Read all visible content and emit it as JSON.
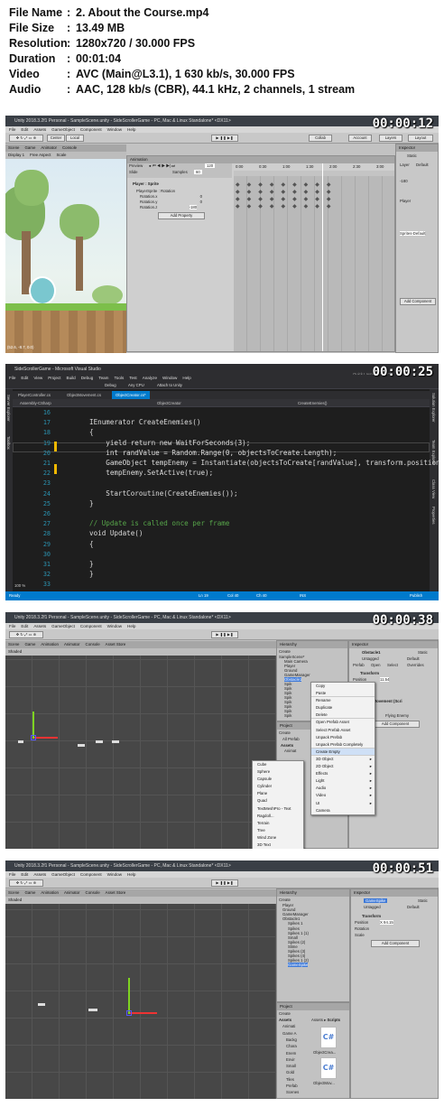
{
  "info": {
    "rows": [
      {
        "key": "File Name",
        "value": "2. About the Course.mp4"
      },
      {
        "key": "File Size",
        "value": "13.49 MB"
      },
      {
        "key": "Resolution",
        "value": "1280x720 / 30.000 FPS"
      },
      {
        "key": "Duration",
        "value": "00:01:04"
      },
      {
        "key": "Video",
        "value": "AVC (Main@L3.1), 1 630 kb/s, 30.000 FPS"
      },
      {
        "key": "Audio",
        "value": "AAC, 128 kb/s (CBR), 44.1 kHz, 2 channels, 1 stream"
      }
    ]
  },
  "frames": [
    {
      "timestamp": "00:00:12",
      "title": "Unity 2018.3.2f1 Personal - SampleScene.unity - SideScrollerGame - PC, Mac & Linux Standalone* <DX11>",
      "menu": [
        "File",
        "Edit",
        "Assets",
        "GameObject",
        "Component",
        "Window",
        "Help"
      ],
      "tool": {
        "center": "Center",
        "local": "Local",
        "collab": "Collab",
        "account": "Account",
        "layers": "Layers",
        "layout": "Layout"
      },
      "tabs": [
        "Scene",
        "Game",
        "Animator",
        "Console"
      ],
      "display": "Display 1",
      "aspect": "Free Aspect",
      "scale": "Scale",
      "animation": {
        "tab": "Animation",
        "preview": "Preview",
        "clip": "Slide",
        "samples_label": "Samples",
        "samples": "60",
        "frame_value": "120",
        "time_marks": [
          "0:00",
          "0:30",
          "1:00",
          "1:30",
          "2:00",
          "2:30",
          "3:00"
        ],
        "object": "Player : Sprite",
        "group": "PlayerSprite : Rotation",
        "props": [
          {
            "name": "Rotation.x",
            "value": "0"
          },
          {
            "name": "Rotation.y",
            "value": "0"
          },
          {
            "name": "Rotation.z",
            "value": "-180"
          }
        ],
        "add_button": "Add Property"
      },
      "coords": "(52.6, -8.7, 0.0)",
      "inspector": {
        "tab": "Inspector",
        "static": "Static",
        "layer": "Layer",
        "default": "Default",
        "player": "Player",
        "value": "-180",
        "sprite_default": "Sprites-Default",
        "add_component": "Add Component"
      }
    },
    {
      "timestamp": "00:00:25",
      "title": "SideScrollerGame - Microsoft Visual Studio",
      "quick_launch": "Quick Launch (Ctrl+Q)",
      "user": "Phanender",
      "menu": [
        "File",
        "Edit",
        "View",
        "Project",
        "Build",
        "Debug",
        "Team",
        "Tools",
        "Test",
        "Analyze",
        "Window",
        "Help"
      ],
      "toolbar": {
        "debug": "Debug",
        "cpu": "Any CPU",
        "attach": "Attach to Unity"
      },
      "file_tabs": [
        "PlayerController.cs",
        "ObjectMovement.cs",
        "ObjectCreator.cs*"
      ],
      "nav": {
        "project": "Assembly-CSharp",
        "class": "ObjectCreator",
        "method": "CreateEnemies()"
      },
      "side_left": [
        "Server Explorer",
        "Toolbox"
      ],
      "side_right": [
        "Solution Explorer",
        "Team Explorer",
        "Class View",
        "Properties"
      ],
      "code": [
        {
          "n": "16",
          "t": ""
        },
        {
          "n": "17",
          "t": "IEnumerator CreateEnemies()"
        },
        {
          "n": "18",
          "t": "{"
        },
        {
          "n": "19",
          "t": "    yield return new WaitForSeconds(3);"
        },
        {
          "n": "20",
          "t": "    int randValue = Random.Range(0, objectsToCreate.Length);"
        },
        {
          "n": "21",
          "t": "    GameObject tempEnemy = Instantiate(objectsToCreate[randValue], transform.position"
        },
        {
          "n": "22",
          "t": "    tempEnemy.SetActive(true);"
        },
        {
          "n": "23",
          "t": ""
        },
        {
          "n": "24",
          "t": "    StartCoroutine(CreateEnemies());"
        },
        {
          "n": "25",
          "t": "}"
        },
        {
          "n": "26",
          "t": ""
        },
        {
          "n": "27",
          "t": "// Update is called once per frame"
        },
        {
          "n": "28",
          "t": "void Update()"
        },
        {
          "n": "29",
          "t": "{"
        },
        {
          "n": "30",
          "t": ""
        },
        {
          "n": "31",
          "t": "}"
        },
        {
          "n": "32",
          "t": "}"
        },
        {
          "n": "33",
          "t": ""
        }
      ],
      "zoom": "100 %",
      "status": {
        "ready": "Ready",
        "ln": "Ln 19",
        "col": "Col 40",
        "ch": "Ch 40",
        "ins": "INS",
        "publish": "Publish"
      }
    },
    {
      "timestamp": "00:00:38",
      "title": "Unity 2018.3.2f1 Personal - SampleScene.unity - SideScrollerGame - PC, Mac & Linux Standalone* <DX11>",
      "menu": [
        "File",
        "Edit",
        "Assets",
        "GameObject",
        "Component",
        "Window",
        "Help"
      ],
      "tabs": [
        "Scene",
        "Game",
        "Animation",
        "Animator",
        "Console",
        "Asset Store"
      ],
      "shaded": "Shaded",
      "hierarchy": {
        "tab": "Hierarchy",
        "create": "Create",
        "items": [
          "SampleScene*",
          "Main Camera",
          "Player",
          "Ground",
          "GameManager",
          "Obstacle1",
          "Spik",
          "Spik",
          "Spik",
          "Spik",
          "Spik",
          "Spik",
          "Spik",
          "Spik"
        ]
      },
      "context_menu": [
        "Copy",
        "Paste",
        "Rename",
        "Duplicate",
        "Delete",
        "Open Prefab Asset",
        "Select Prefab Asset",
        "Unpack Prefab",
        "Unpack Prefab Completely",
        "Create Empty",
        "3D Object",
        "2D Object",
        "Effects",
        "Light",
        "Audio",
        "Video",
        "UI",
        "Camera"
      ],
      "submenu": [
        "Cube",
        "Sphere",
        "Capsule",
        "Cylinder",
        "Plane",
        "Quad",
        "TextMeshPro - Text",
        "Ragdoll...",
        "Terrain",
        "Tree",
        "Wind Zone",
        "3D Text"
      ],
      "inspector": {
        "tab": "Inspector",
        "name": "Obstacle1",
        "static": "Static",
        "tag": "Untagged",
        "layer": "Default",
        "prefab": "Prefab",
        "open": "Open",
        "select": "Select",
        "overrides": "Overrides",
        "transform": "Transform",
        "position": "Position",
        "pos_x": "11.54",
        "rotation": "Rotation",
        "scale": "Scale",
        "movement": "Object Movement (Scri",
        "type": "Flying Enemy",
        "add_component": "Add Component"
      },
      "project": {
        "tab": "Project",
        "create": "Create",
        "items": [
          "All Prefab",
          "Assets",
          "Animat"
        ]
      }
    },
    {
      "timestamp": "00:00:51",
      "title": "Unity 2018.3.2f1 Personal - SampleScene.unity - SideScrollerGame - PC, Mac & Linux Standalone* <DX11>",
      "menu": [
        "File",
        "Edit",
        "Assets",
        "GameObject",
        "Component",
        "Window",
        "Help"
      ],
      "tabs": [
        "Scene",
        "Game",
        "Animation",
        "Animator",
        "Console",
        "Asset Store"
      ],
      "shaded": "Shaded",
      "hierarchy": {
        "tab": "Hierarchy",
        "create": "Create",
        "items": [
          "Player",
          "Ground",
          "GameManager",
          "Obstacle1",
          "Spikes 1",
          "Spikes",
          "Spikes 1 (1)",
          "Small",
          "Spikes (2)",
          "Slime",
          "Spikes (3)",
          "Spikes (4)",
          "Spikes 1 (2)",
          "GameSpike"
        ]
      },
      "inspector": {
        "tab": "Inspector",
        "name": "GameSpike",
        "static": "Static",
        "tag": "Untagged",
        "layer": "Default",
        "transform": "Transform",
        "position": "Position",
        "pos_x": "X 94.15",
        "rotation": "Rotation",
        "scale": "Scale",
        "add_component": "Add Component"
      },
      "project": {
        "tab": "Project",
        "create": "Create",
        "tree": [
          "Assets",
          "Animati",
          "Game A",
          "Backg",
          "Chara",
          "Enem",
          "Envir",
          "Small",
          "Gold",
          "Tiles",
          "Prefab",
          "Scenes"
        ],
        "breadcrumb": [
          "Assets",
          "Scripts"
        ],
        "files": [
          "ObjectCrea...",
          "ObjectMov..."
        ]
      }
    }
  ]
}
